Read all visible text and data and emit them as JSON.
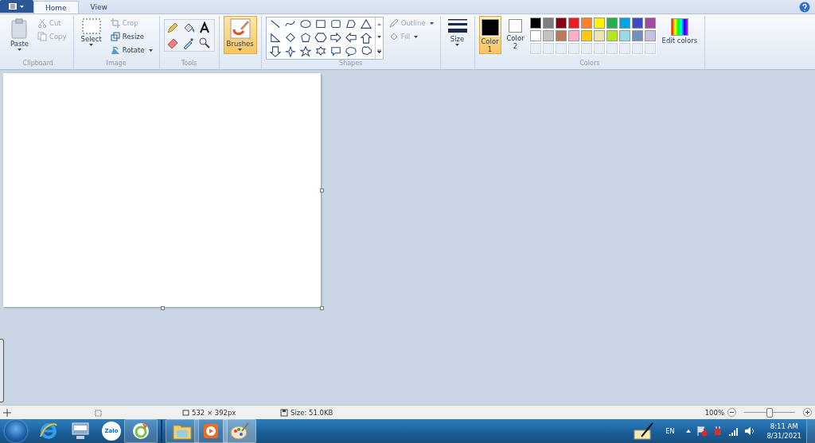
{
  "tabs": [
    {
      "label": "Home",
      "selected": true
    },
    {
      "label": "View",
      "selected": false
    }
  ],
  "clipboard": {
    "paste": "Paste",
    "cut": "Cut",
    "copy": "Copy",
    "group": "Clipboard"
  },
  "image": {
    "select": "Select",
    "crop": "Crop",
    "resize": "Resize",
    "rotate": "Rotate",
    "group": "Image"
  },
  "tools": {
    "group": "Tools"
  },
  "brushes": {
    "label": "Brushes",
    "selected": true
  },
  "shapes": {
    "outline": "Outline",
    "fill": "Fill",
    "group": "Shapes"
  },
  "size": {
    "label": "Size"
  },
  "colors": {
    "group": "Colors",
    "edit": "Edit colors",
    "slots": [
      {
        "label": "Color",
        "number": "1",
        "color": "#000000",
        "selected": true
      },
      {
        "label": "Color",
        "number": "2",
        "color": "#ffffff",
        "selected": false
      }
    ],
    "palette": [
      {
        "color": "#000000"
      },
      {
        "color": "#7f7f7f"
      },
      {
        "color": "#880015"
      },
      {
        "color": "#ed1c24"
      },
      {
        "color": "#ff7f27"
      },
      {
        "color": "#fff200"
      },
      {
        "color": "#22b14c"
      },
      {
        "color": "#00a2e8"
      },
      {
        "color": "#3f48cc"
      },
      {
        "color": "#a349a4"
      },
      {
        "color": "#ffffff"
      },
      {
        "color": "#c3c3c3"
      },
      {
        "color": "#b97a57"
      },
      {
        "color": "#ffaec9"
      },
      {
        "color": "#ffc90e"
      },
      {
        "color": "#efe4b0"
      },
      {
        "color": "#b5e61d"
      },
      {
        "color": "#99d9ea"
      },
      {
        "color": "#7092be"
      },
      {
        "color": "#c8bfe7"
      }
    ]
  },
  "status_bar": {
    "image_size": "532 × 392px",
    "file_size": "Size: 51.0KB",
    "zoom": "100%",
    "level": 0.5
  },
  "taskbar": {
    "zalo": "Zalo",
    "language": "EN",
    "time": "8:11 AM",
    "date": "8/31/2021"
  }
}
